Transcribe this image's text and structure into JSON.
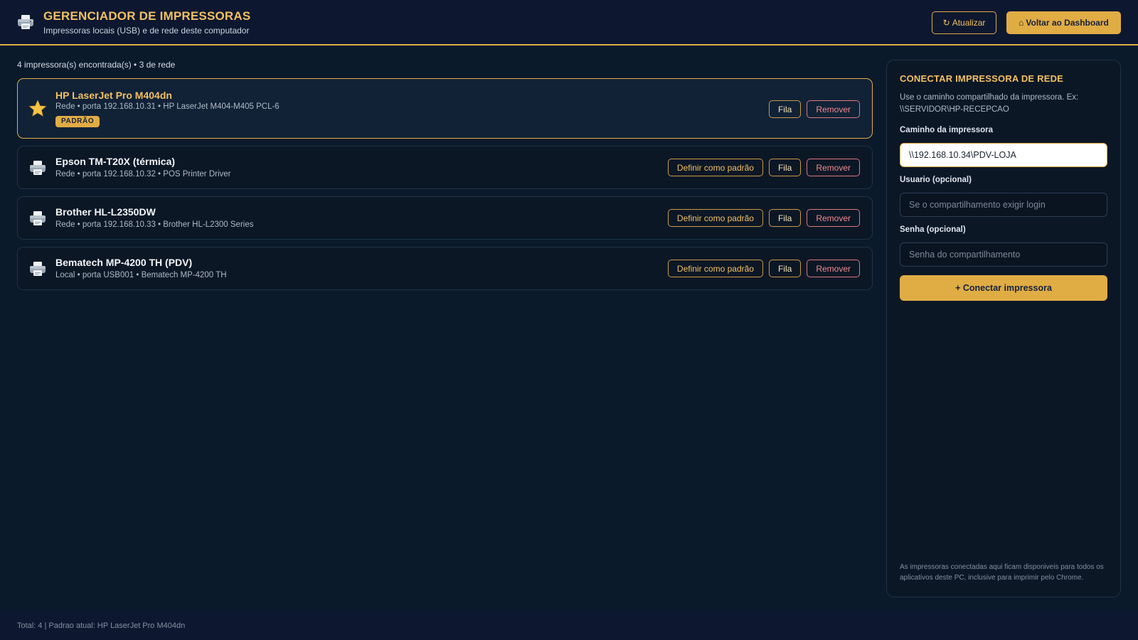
{
  "header": {
    "icon": "printer-icon",
    "title": "GERENCIADOR DE IMPRESSORAS",
    "subtitle": "Impressoras locais (USB) e de rede deste computador",
    "refresh_icon": "↻",
    "refresh_label": "Atualizar",
    "dashboard_icon": "⌂",
    "dashboard_label": "Voltar ao Dashboard"
  },
  "summary": "4 impressora(s) encontrada(s) • 3 de rede",
  "printers": [
    {
      "name": "HP LaserJet Pro M404dn",
      "meta": "Rede • porta 192.168.10.31 • HP LaserJet M404-M405 PCL-6",
      "icon": "star-icon",
      "is_default": true,
      "badge": "PADRÃO",
      "actions": {
        "queue": "Fila",
        "remove": "Remover"
      }
    },
    {
      "name": "Epson TM-T20X (térmica)",
      "meta": "Rede • porta 192.168.10.32 • POS Printer Driver",
      "icon": "printer-icon",
      "is_default": false,
      "actions": {
        "set_default": "Definir como padrão",
        "queue": "Fila",
        "remove": "Remover"
      }
    },
    {
      "name": "Brother HL-L2350DW",
      "meta": "Rede • porta 192.168.10.33 • Brother HL-L2300 Series",
      "icon": "printer-icon",
      "is_default": false,
      "actions": {
        "set_default": "Definir como padrão",
        "queue": "Fila",
        "remove": "Remover"
      }
    },
    {
      "name": "Bematech MP-4200 TH (PDV)",
      "meta": "Local • porta USB001 • Bematech MP-4200 TH",
      "icon": "printer-icon",
      "is_default": false,
      "actions": {
        "set_default": "Definir como padrão",
        "queue": "Fila",
        "remove": "Remover"
      }
    }
  ],
  "connect_panel": {
    "title": "CONECTAR IMPRESSORA DE REDE",
    "description": "Use o caminho compartilhado da impressora. Ex: \\\\SERVIDOR\\HP-RECEPCAO",
    "path_label": "Caminho da impressora",
    "path_value": "\\\\192.168.10.34\\PDV-LOJA",
    "user_label": "Usuario (opcional)",
    "user_placeholder": "Se o compartilhamento exigir login",
    "password_label": "Senha (opcional)",
    "password_placeholder": "Senha do compartilhamento",
    "connect_label": "+ Conectar impressora",
    "footnote": "As impressoras conectadas aqui ficam disponiveis para todos os aplicativos deste PC, inclusive para imprimir pelo Chrome."
  },
  "footer": "Total: 4 | Padrao atual: HP LaserJet Pro M404dn",
  "colors": {
    "background": "#0b1a2b",
    "accent": "#e0ac44",
    "accent_text": "#f2c061",
    "danger": "#f08a8e"
  }
}
